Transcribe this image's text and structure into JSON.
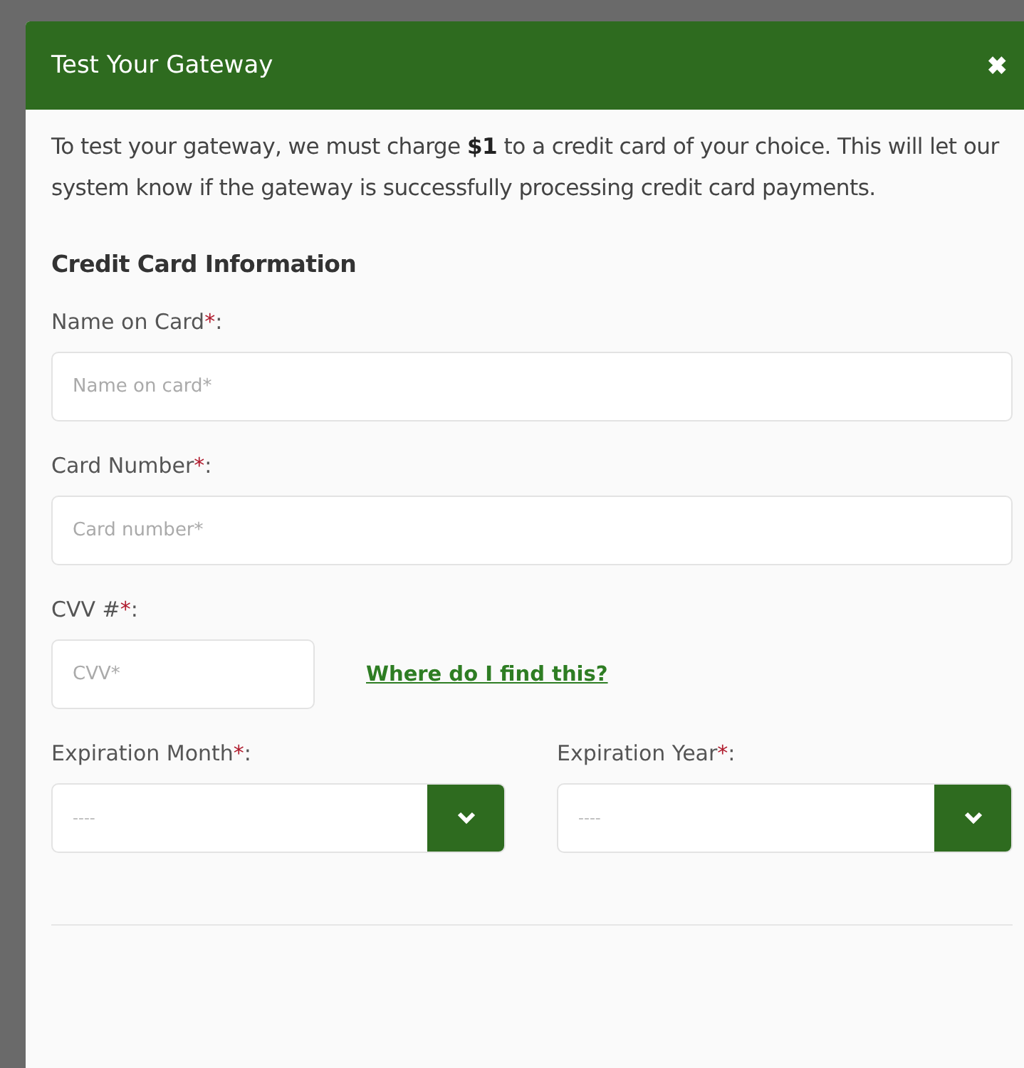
{
  "dialog": {
    "title": "Test Your Gateway",
    "close": "✖"
  },
  "intro": "To test your gateway, we must charge **$1** to a credit card of your choice. This will let our system know if the gateway is successfully processing credit card payments.",
  "section_title": "Credit Card Information",
  "fields": [
    {
      "kind": "text",
      "label": "Name on Card",
      "required_mark": "*",
      "label_end": ":",
      "placeholder": "Name on card*"
    },
    {
      "kind": "text",
      "label": "Card Number",
      "required_mark": "*",
      "label_end": ":",
      "placeholder": "Card number*"
    },
    {
      "kind": "short",
      "label": "CVV #",
      "required_mark": "*",
      "label_end": ":",
      "placeholder": "CVV*",
      "link": "Where do I find this?"
    }
  ],
  "selects": [
    {
      "label": "Expiration Month",
      "required_mark": "*",
      "label_end": ":",
      "value": "----"
    },
    {
      "label": "Expiration Year",
      "required_mark": "*",
      "label_end": ":",
      "value": "----"
    }
  ]
}
